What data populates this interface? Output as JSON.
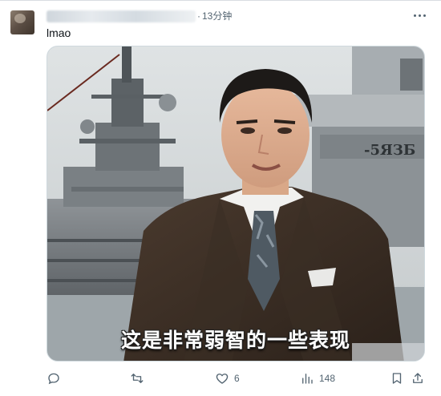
{
  "post": {
    "author_name": "",
    "time_separator": "·",
    "timestamp": "13分钟",
    "text": "lmao"
  },
  "media": {
    "subtitle": "这是非常弱智的一些表现",
    "hull_text": "-5ЯЗБ"
  },
  "actions": {
    "reply": {
      "icon": "reply-icon",
      "count": ""
    },
    "retweet": {
      "icon": "retweet-icon",
      "count": ""
    },
    "like": {
      "icon": "heart-icon",
      "count": "6"
    },
    "views": {
      "icon": "views-icon",
      "count": "148"
    },
    "bookmark": {
      "icon": "bookmark-icon"
    },
    "share": {
      "icon": "share-icon"
    }
  },
  "colors": {
    "text_primary": "#0f1419",
    "text_secondary": "#536471",
    "border": "#cfd9de"
  }
}
